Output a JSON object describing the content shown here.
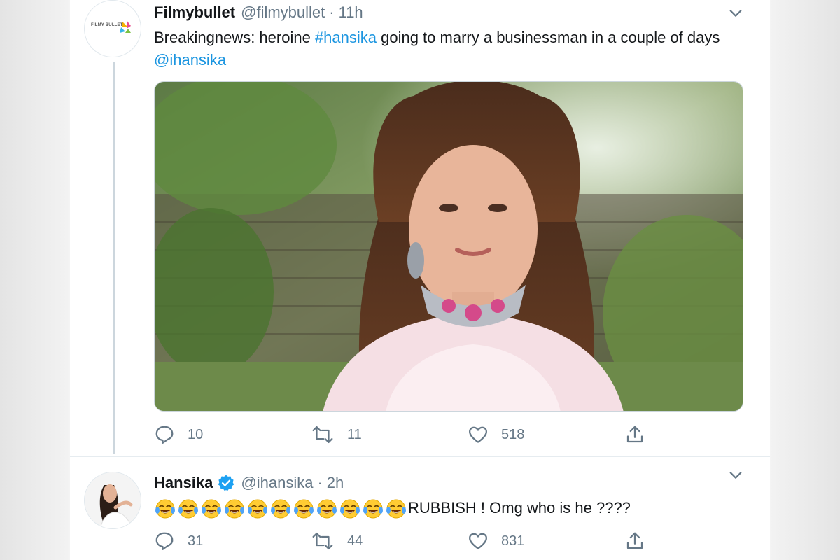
{
  "colors": {
    "text_primary": "#14171a",
    "text_secondary": "#657786",
    "link": "#1b95e0",
    "verified": "#1da1f2",
    "border": "#ccd6dd"
  },
  "tweets": [
    {
      "avatar": {
        "label": "FILMY BULLET",
        "icon": "filmybullet-logo-icon"
      },
      "display_name": "Filmybullet",
      "handle": "@filmybullet",
      "separator": "·",
      "time": "11h",
      "verified": false,
      "text_parts": [
        "Breakingnews: heroine ",
        "#hansika",
        " going to marry a businessman in a couple of days ",
        "@ihansika"
      ],
      "media": {
        "icon": "photo-woman-portrait"
      },
      "actions": {
        "reply": "10",
        "retweet": "11",
        "like": "518"
      }
    },
    {
      "avatar": {
        "icon": "profile-photo-icon"
      },
      "display_name": "Hansika",
      "handle": "@ihansika",
      "separator": "·",
      "time": "2h",
      "verified": true,
      "emoji_count": 11,
      "text": "RUBBISH ! Omg who is he ????",
      "actions": {
        "reply": "31",
        "retweet": "44",
        "like": "831"
      }
    }
  ]
}
